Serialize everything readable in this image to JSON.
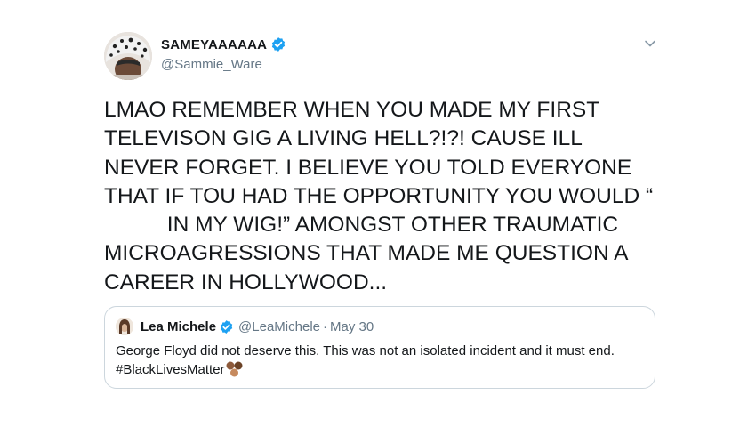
{
  "tweet": {
    "display_name": "SAMEYAAAAAA",
    "handle": "@Sammie_Ware",
    "text_part1": "LMAO REMEMBER WHEN YOU MADE MY FIRST TELEVISON GIG A LIVING HELL?!?! CAUSE ILL NEVER FORGET. I BELIEVE YOU TOLD EVERYONE THAT IF TOU HAD THE OPPORTUNITY YOU WOULD “",
    "text_part2": " IN MY WIG!” AMONGST OTHER TRAUMATIC MICROAGRESSIONS THAT MADE ME QUESTION A CAREER IN HOLLYWOOD..."
  },
  "quoted_tweet": {
    "display_name": "Lea Michele",
    "handle": "@LeaMichele",
    "separator": "·",
    "date": "May 30",
    "text": "George Floyd did not deserve this. This was not an isolated incident and it must end. #BlackLivesMatter"
  },
  "colors": {
    "verified_blue": "#1da1f2",
    "text_primary": "#14171a",
    "text_secondary": "#657786",
    "border": "#ccd6dd"
  },
  "icons": {
    "verified": "verified-badge-icon",
    "caret": "chevron-down-icon",
    "emoji": "raised-fist-emoji-icons"
  }
}
